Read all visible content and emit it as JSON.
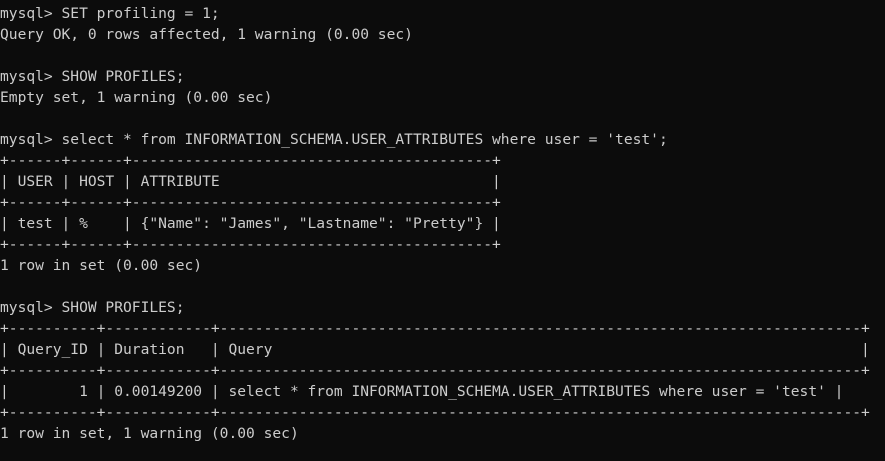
{
  "terminal": {
    "colors": {
      "background": "#0c0c0c",
      "foreground": "#cccccc"
    },
    "lines": [
      "mysql> SET profiling = 1;",
      "Query OK, 0 rows affected, 1 warning (0.00 sec)",
      "",
      "mysql> SHOW PROFILES;",
      "Empty set, 1 warning (0.00 sec)",
      "",
      "mysql> select * from INFORMATION_SCHEMA.USER_ATTRIBUTES where user = 'test';",
      "+------+------+-----------------------------------------+",
      "| USER | HOST | ATTRIBUTE                               |",
      "+------+------+-----------------------------------------+",
      "| test | %    | {\"Name\": \"James\", \"Lastname\": \"Pretty\"} |",
      "+------+------+-----------------------------------------+",
      "1 row in set (0.00 sec)",
      "",
      "mysql> SHOW PROFILES;",
      "+----------+------------+-------------------------------------------------------------------------+",
      "| Query_ID | Duration   | Query                                                                   |",
      "+----------+------------+-------------------------------------------------------------------------+",
      "|        1 | 0.00149200 | select * from INFORMATION_SCHEMA.USER_ATTRIBUTES where user = 'test' |",
      "+----------+------------+-------------------------------------------------------------------------+",
      "1 row in set, 1 warning (0.00 sec)"
    ]
  }
}
